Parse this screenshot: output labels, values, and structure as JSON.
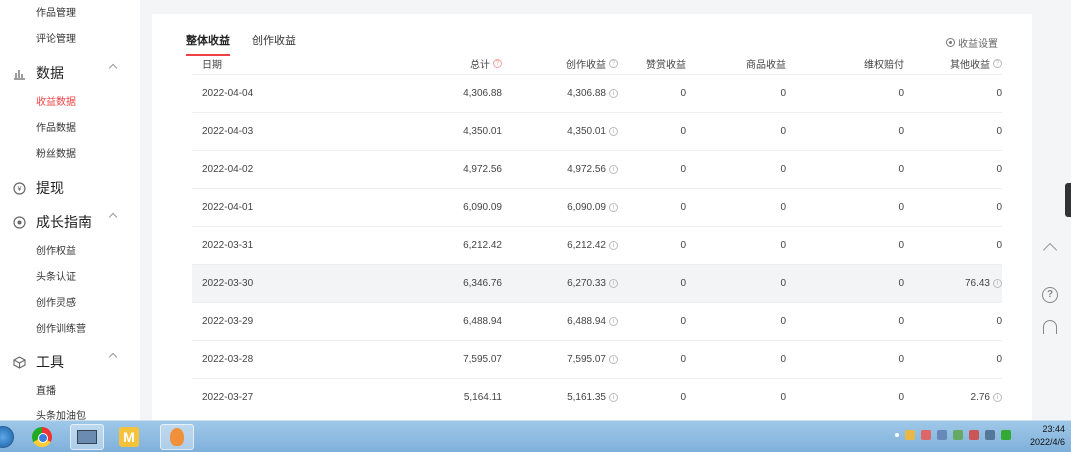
{
  "sidebar": {
    "items_top": [
      "作品管理",
      "评论管理"
    ],
    "groups": [
      {
        "icon": "bar-chart-icon",
        "label": "数据",
        "items": [
          "收益数据",
          "作品数据",
          "粉丝数据"
        ]
      },
      {
        "icon": "withdraw-icon",
        "label": "提现",
        "items": []
      },
      {
        "icon": "growth-icon",
        "label": "成长指南",
        "items": [
          "创作权益",
          "头条认证",
          "创作灵感",
          "创作训练营"
        ]
      },
      {
        "icon": "cube-icon",
        "label": "工具",
        "items": [
          "直播",
          "头条加油包"
        ]
      }
    ],
    "active_item": "收益数据",
    "accent_color": "#f04142"
  },
  "tabs": [
    "整体收益",
    "创作收益"
  ],
  "settings_label": "收益设置",
  "table": {
    "headers": [
      "日期",
      "总计",
      "创作收益",
      "赞赏收益",
      "商品收益",
      "维权赔付",
      "其他收益"
    ],
    "rows": [
      [
        "2022-04-04",
        "4,306.88",
        "4,306.88",
        "0",
        "0",
        "0",
        "0"
      ],
      [
        "2022-04-03",
        "4,350.01",
        "4,350.01",
        "0",
        "0",
        "0",
        "0"
      ],
      [
        "2022-04-02",
        "4,972.56",
        "4,972.56",
        "0",
        "0",
        "0",
        "0"
      ],
      [
        "2022-04-01",
        "6,090.09",
        "6,090.09",
        "0",
        "0",
        "0",
        "0"
      ],
      [
        "2022-03-31",
        "6,212.42",
        "6,212.42",
        "0",
        "0",
        "0",
        "0"
      ],
      [
        "2022-03-30",
        "6,346.76",
        "6,270.33",
        "0",
        "0",
        "0",
        "76.43"
      ],
      [
        "2022-03-29",
        "6,488.94",
        "6,488.94",
        "0",
        "0",
        "0",
        "0"
      ],
      [
        "2022-03-28",
        "7,595.07",
        "7,595.07",
        "0",
        "0",
        "0",
        "0"
      ],
      [
        "2022-03-27",
        "5,164.11",
        "5,161.35",
        "0",
        "0",
        "0",
        "2.76"
      ]
    ],
    "highlighted_row": "2022-03-30"
  },
  "taskbar": {
    "time": "23:44",
    "date": "2022/4/6",
    "apps": [
      "chrome-icon",
      "explorer-icon",
      "m-app-icon",
      "flame-app-icon"
    ]
  }
}
